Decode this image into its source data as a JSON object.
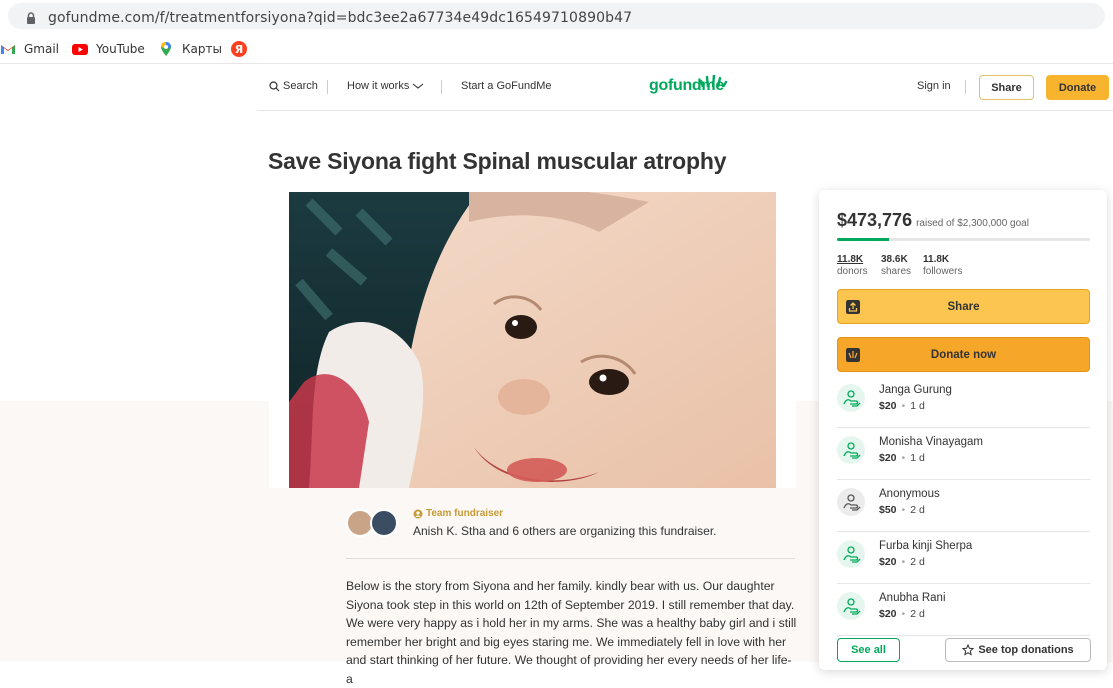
{
  "browser": {
    "url": "gofundme.com/f/treatmentforsiyona?qid=bdc3ee2a67734e49dc16549710890b47",
    "bookmarks": [
      {
        "label": "Gmail",
        "icon": "gmail-icon"
      },
      {
        "label": "YouTube",
        "icon": "youtube-icon"
      },
      {
        "label": "Карты",
        "icon": "maps-icon"
      },
      {
        "label": "",
        "icon": "yandex-icon"
      }
    ]
  },
  "header": {
    "search": "Search",
    "how_it_works": "How it works",
    "start": "Start a GoFundMe",
    "logo": "gofundme",
    "sign_in": "Sign in",
    "share": "Share",
    "donate": "Donate"
  },
  "campaign": {
    "title": "Save Siyona fight Spinal muscular atrophy",
    "team_badge": "Team fundraiser",
    "organizers": "Anish K. Stha and 6 others are organizing this fundraiser.",
    "story": "Below is the story from Siyona and her family. kindly bear with us. Our daughter Siyona took step in this world on 12th of September 2019. I still remember that day. We were very happy as i hold her in my arms. She was a healthy baby girl and i still remember her bright and big eyes staring me. We immediately fell in love with her and start thinking of her future. We thought of providing her every needs of her life- a"
  },
  "card": {
    "raised": "$473,776",
    "goal": "raised of $2,300,000 goal",
    "progress_fraction": 0.206,
    "stats": [
      {
        "value": "11.8K",
        "label": "donors"
      },
      {
        "value": "38.6K",
        "label": "shares"
      },
      {
        "value": "11.8K",
        "label": "followers"
      }
    ],
    "share_button": "Share",
    "donate_button": "Donate now",
    "donors": [
      {
        "name": "Janga Gurung",
        "amount": "$20",
        "time": "1 d"
      },
      {
        "name": "Monisha Vinayagam",
        "amount": "$20",
        "time": "1 d"
      },
      {
        "name": "Anonymous",
        "amount": "$50",
        "time": "2 d"
      },
      {
        "name": "Furba kinji Sherpa",
        "amount": "$20",
        "time": "2 d"
      },
      {
        "name": "Anubha Rani",
        "amount": "$20",
        "time": "2 d"
      }
    ],
    "see_all": "See all",
    "see_top": "See top donations"
  },
  "colors": {
    "brand_green": "#02a95c",
    "donate_orange": "#f9b42f",
    "beige_bg": "#fbf8f6"
  }
}
